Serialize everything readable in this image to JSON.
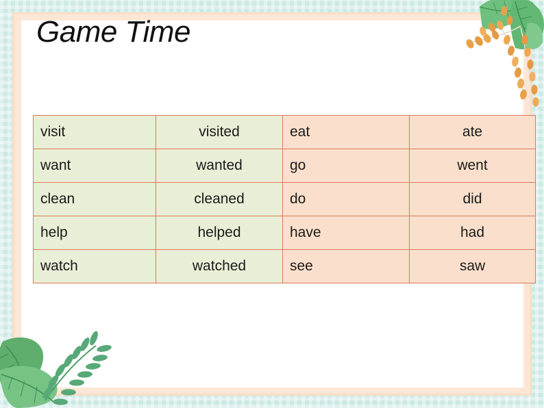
{
  "slide": {
    "title": "Game Time",
    "colors": {
      "frame_outer_mint": "#cbe9e4",
      "frame_inner_peach": "#fbdec6",
      "content_white": "#ffffff",
      "cell_green": "#e9eed6",
      "cell_peach": "#fae0cc",
      "cell_border": "#d9795a",
      "text_black": "#1a1a1a",
      "text_red": "#e8251a",
      "leaf_green": "#5bb070",
      "berry_orange": "#e8a14a"
    }
  },
  "table": {
    "columns": [
      {
        "key": "regular_base",
        "group": "regular"
      },
      {
        "key": "regular_past",
        "group": "regular"
      },
      {
        "key": "irregular_base",
        "group": "irregular"
      },
      {
        "key": "irregular_past",
        "group": "irregular"
      }
    ],
    "rows": [
      {
        "regular_base": "visit",
        "regular_past": "visited",
        "regular_past_color": "black",
        "irregular_base": "eat",
        "irregular_past": "ate",
        "irregular_past_color": "black"
      },
      {
        "regular_base": "want",
        "regular_past": "wanted",
        "regular_past_color": "red",
        "irregular_base": "go",
        "irregular_past": "went",
        "irregular_past_color": "red"
      },
      {
        "regular_base": "clean",
        "regular_past": "cleaned",
        "regular_past_color": "red",
        "irregular_base": "do",
        "irregular_past": "did",
        "irregular_past_color": "red"
      },
      {
        "regular_base": "help",
        "regular_past": "helped",
        "regular_past_color": "red",
        "irregular_base": "have",
        "irregular_past": "had",
        "irregular_past_color": "red"
      },
      {
        "regular_base": "watch",
        "regular_past": "watched",
        "regular_past_color": "red",
        "irregular_base": "see",
        "irregular_past": "saw",
        "irregular_past_color": "red"
      }
    ]
  },
  "decorations": [
    {
      "name": "leaf-berry-branch-top-right",
      "position": "top-right"
    },
    {
      "name": "leaf-fern-branch-bottom-left",
      "position": "bottom-left"
    }
  ]
}
